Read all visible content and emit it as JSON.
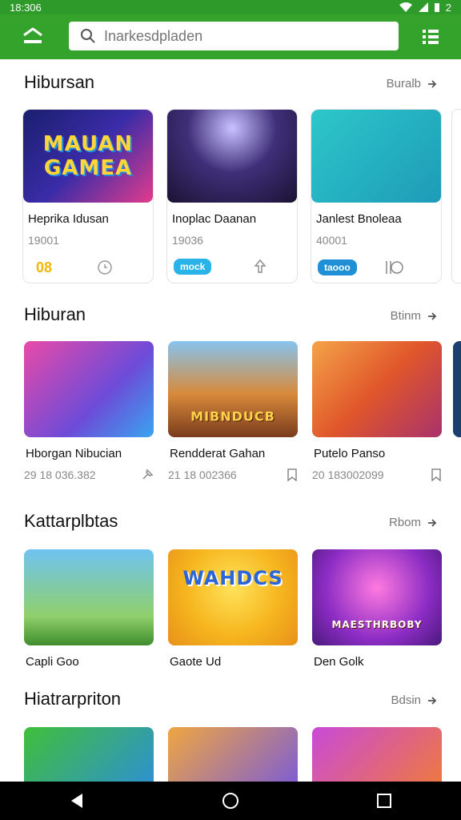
{
  "status": {
    "time": "18:306",
    "battery": "2"
  },
  "search": {
    "placeholder": "Inarkesdpladen"
  },
  "sections": [
    {
      "title": "Hibursan",
      "see_more": "Buralb",
      "items": [
        {
          "art_text": "MAUAN GAMEA",
          "name": "Heprika Idusan",
          "meta": "19001",
          "badge": "08",
          "badge_color": "#f2b705"
        },
        {
          "art_text": "",
          "name": "Inoplac Daanan",
          "meta": "19036",
          "badge": "mock",
          "badge_color": "#2ab3e8"
        },
        {
          "art_text": "",
          "name": "Janlest Bnoleaa",
          "meta": "40001",
          "badge": "taooo",
          "badge_color": "#1f8fd6"
        }
      ]
    },
    {
      "title": "Hiburan",
      "see_more": "Btinm",
      "items": [
        {
          "art_text": "",
          "name": "Hborgan Nibucian",
          "meta": "29 18 036.382"
        },
        {
          "art_text": "MIBNDUCB",
          "name": "Rendderat Gahan",
          "meta": "21 18 002366"
        },
        {
          "art_text": "",
          "name": "Putelo Panso",
          "meta": "20 183002099"
        }
      ]
    },
    {
      "title": "Kattarplbtas",
      "see_more": "Rbom",
      "items": [
        {
          "art_text": "",
          "name": "Capli Goo"
        },
        {
          "art_text": "WAHDCS",
          "name": "Gaote Ud"
        },
        {
          "art_text": "MAESTHRBOBY",
          "name": "Den Golk"
        }
      ]
    },
    {
      "title": "Hiatrarpriton",
      "see_more": "Bdsin",
      "items": [
        {
          "art_text": ""
        },
        {
          "art_text": ""
        },
        {
          "art_text": ""
        }
      ]
    }
  ]
}
